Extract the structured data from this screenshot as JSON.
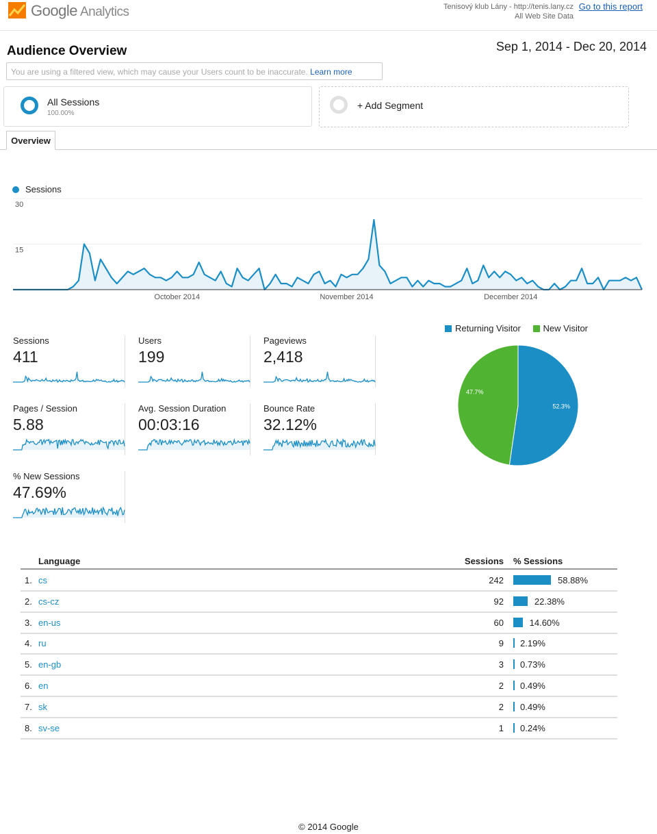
{
  "header": {
    "logo_text": "Google",
    "logo_sub": "Analytics",
    "account_name": "Tenisový klub Lány - http://tenis.lany.cz",
    "view_name": "All Web Site Data",
    "goto_link": "Go to this report"
  },
  "page": {
    "title": "Audience Overview",
    "date_range": "Sep 1, 2014 - Dec 20, 2014",
    "notice_text": "You are using a filtered view, which may cause your Users count to be inaccurate.",
    "notice_link": "Learn more"
  },
  "segments": {
    "active": {
      "name": "All Sessions",
      "percent": "100.00%"
    },
    "add_label": "+ Add Segment"
  },
  "tabs": [
    {
      "label": "Overview",
      "active": true
    }
  ],
  "colors": {
    "accent": "#1b8ec6",
    "returning": "#1b8ec6",
    "new": "#50b432",
    "link": "#1a5fb4"
  },
  "chart_data": [
    {
      "type": "area",
      "title": "",
      "legend": [
        "Sessions"
      ],
      "ylabel": "",
      "ylim": [
        0,
        30
      ],
      "yticks": [
        "30",
        "15"
      ],
      "xticks": [
        {
          "label": "October 2014",
          "day_index": 30
        },
        {
          "label": "November 2014",
          "day_index": 61
        },
        {
          "label": "December 2014",
          "day_index": 91
        }
      ],
      "x_start": "2014-09-01",
      "x_end": "2014-12-20",
      "series": [
        {
          "name": "Sessions",
          "values": [
            0,
            0,
            0,
            0,
            0,
            0,
            0,
            0,
            0,
            0,
            0,
            1,
            3,
            15,
            12,
            3,
            10,
            7,
            4,
            2,
            4,
            6,
            5,
            6,
            7,
            5,
            4,
            4,
            3,
            4,
            6,
            4,
            4,
            5,
            9,
            5,
            4,
            3,
            6,
            2,
            1,
            7,
            4,
            3,
            5,
            7,
            0,
            2,
            5,
            2,
            2,
            1,
            4,
            3,
            2,
            5,
            6,
            2,
            3,
            1,
            5,
            4,
            5,
            5,
            7,
            10,
            23,
            8,
            6,
            2,
            3,
            4,
            4,
            1,
            3,
            1,
            3,
            2,
            2,
            1,
            1,
            2,
            3,
            7,
            2,
            3,
            8,
            4,
            6,
            4,
            6,
            5,
            3,
            4,
            2,
            3,
            1,
            0,
            0,
            2,
            0,
            1,
            3,
            3,
            7,
            2,
            2,
            4,
            0,
            3,
            3,
            3,
            4,
            3,
            4,
            0
          ]
        }
      ]
    },
    {
      "type": "pie",
      "title": "",
      "legend": [
        "Returning Visitor",
        "New Visitor"
      ],
      "slices": [
        {
          "name": "Returning Visitor",
          "value": 52.3,
          "label": "52.3%",
          "color": "#1b8ec6"
        },
        {
          "name": "New Visitor",
          "value": 47.7,
          "label": "47.7%",
          "color": "#50b432"
        }
      ]
    },
    {
      "type": "table",
      "title": "Language",
      "columns": [
        "Language",
        "Sessions",
        "% Sessions"
      ],
      "rows": [
        {
          "rank": "1.",
          "language": "cs",
          "sessions": "242",
          "percent": "58.88%",
          "share": 58.88
        },
        {
          "rank": "2.",
          "language": "cs-cz",
          "sessions": "92",
          "percent": "22.38%",
          "share": 22.38
        },
        {
          "rank": "3.",
          "language": "en-us",
          "sessions": "60",
          "percent": "14.60%",
          "share": 14.6
        },
        {
          "rank": "4.",
          "language": "ru",
          "sessions": "9",
          "percent": "2.19%",
          "share": 2.19
        },
        {
          "rank": "5.",
          "language": "en-gb",
          "sessions": "3",
          "percent": "0.73%",
          "share": 0.73
        },
        {
          "rank": "6.",
          "language": "en",
          "sessions": "2",
          "percent": "0.49%",
          "share": 0.49
        },
        {
          "rank": "7.",
          "language": "sk",
          "sessions": "2",
          "percent": "0.49%",
          "share": 0.49
        },
        {
          "rank": "8.",
          "language": "sv-se",
          "sessions": "1",
          "percent": "0.24%",
          "share": 0.24
        }
      ]
    }
  ],
  "metrics": [
    {
      "label": "Sessions",
      "value": "411",
      "spark_seed": 1
    },
    {
      "label": "Users",
      "value": "199",
      "spark_seed": 2
    },
    {
      "label": "Pageviews",
      "value": "2,418",
      "spark_seed": 3
    },
    {
      "label": "Pages / Session",
      "value": "5.88",
      "spark_seed": 4
    },
    {
      "label": "Avg. Session Duration",
      "value": "00:03:16",
      "spark_seed": 5
    },
    {
      "label": "Bounce Rate",
      "value": "32.12%",
      "spark_seed": 6
    },
    {
      "label": "% New Sessions",
      "value": "47.69%",
      "spark_seed": 7
    }
  ],
  "footer": "© 2014 Google"
}
